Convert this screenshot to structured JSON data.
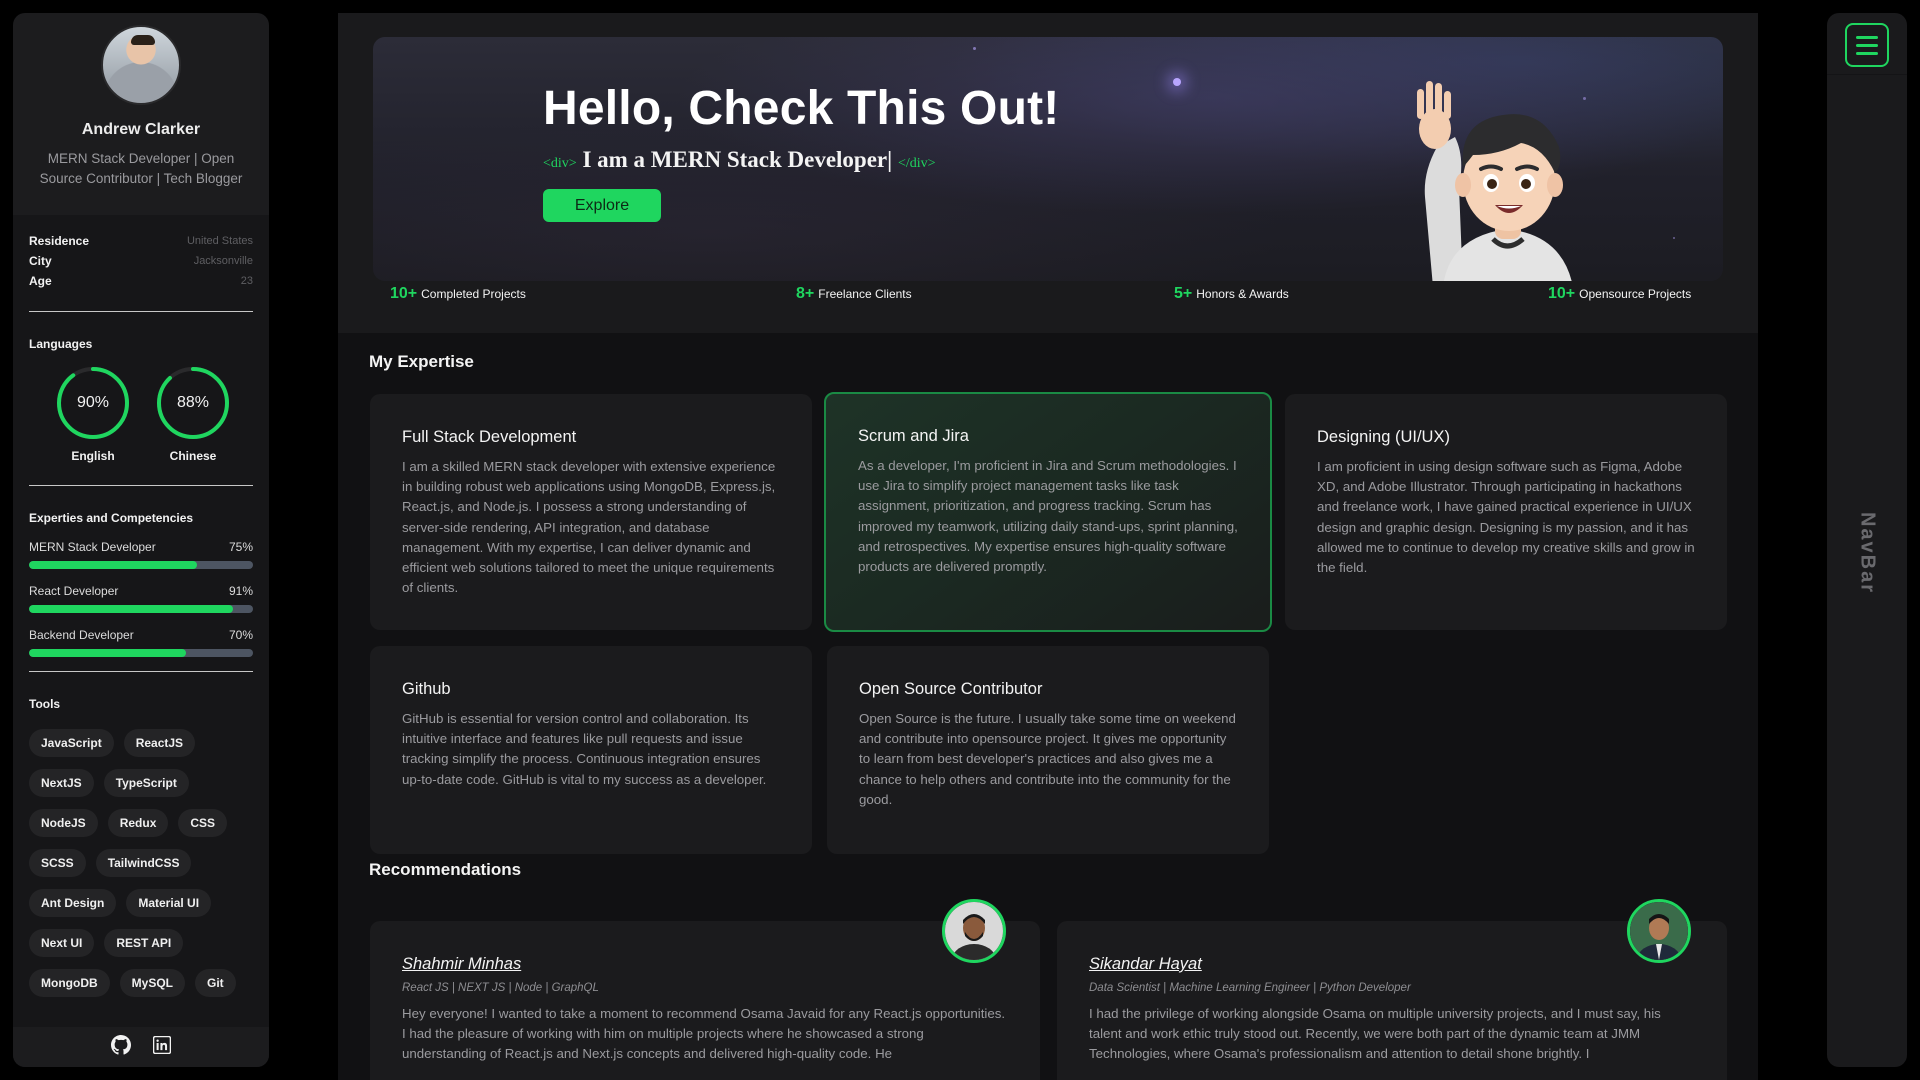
{
  "profile": {
    "name": "Andrew Clarker",
    "role": "MERN Stack Developer | Open Source Contributor | Tech Blogger",
    "info": [
      {
        "label": "Residence",
        "value": "United States"
      },
      {
        "label": "City",
        "value": "Jacksonville"
      },
      {
        "label": "Age",
        "value": "23"
      }
    ]
  },
  "languages": {
    "title": "Languages",
    "items": [
      {
        "name": "English",
        "percent_label": "90%",
        "level": 0.9
      },
      {
        "name": "Chinese",
        "percent_label": "88%",
        "level": 0.88
      }
    ]
  },
  "skills": {
    "title": "Experties and Competencies",
    "items": [
      {
        "name": "MERN Stack Developer",
        "percent_label": "75%",
        "level": 0.75
      },
      {
        "name": "React Developer",
        "percent_label": "91%",
        "level": 0.91
      },
      {
        "name": "Backend Developer",
        "percent_label": "70%",
        "level": 0.7
      }
    ]
  },
  "tools": {
    "title": "Tools",
    "items": [
      "JavaScript",
      "ReactJS",
      "NextJS",
      "TypeScript",
      "NodeJS",
      "Redux",
      "CSS",
      "SCSS",
      "TailwindCSS",
      "Ant Design",
      "Material UI",
      "Next UI",
      "REST API",
      "MongoDB",
      "MySQL",
      "Git"
    ]
  },
  "footer_icons": [
    "github-icon",
    "linkedin-icon"
  ],
  "hero": {
    "title": "Hello, Check This Out!",
    "tag_open": "<div>",
    "subtitle": "I am a MERN Stack Developer|",
    "tag_close": "</div>",
    "button": "Explore"
  },
  "stats": [
    {
      "number": "10+",
      "label": "Completed Projects"
    },
    {
      "number": "8+",
      "label": "Freelance Clients"
    },
    {
      "number": "5+",
      "label": "Honors & Awards"
    },
    {
      "number": "10+",
      "label": "Opensource Projects"
    }
  ],
  "expertise": {
    "title": "My Expertise",
    "cards": [
      {
        "title": "Full Stack Development",
        "text": "I am a skilled MERN stack developer with extensive experience in building robust web applications using MongoDB, Express.js, React.js, and Node.js. I possess a strong understanding of server-side rendering, API integration, and database management. With my expertise, I can deliver dynamic and efficient web solutions tailored to meet the unique requirements of clients."
      },
      {
        "title": "Scrum and Jira",
        "text": "As a developer, I'm proficient in Jira and Scrum methodologies. I use Jira to simplify project management tasks like task assignment, prioritization, and progress tracking. Scrum has improved my teamwork, utilizing daily stand-ups, sprint planning, and retrospectives. My expertise ensures high-quality software products are delivered promptly."
      },
      {
        "title": "Designing (UI/UX)",
        "text": "I am proficient in using design software such as Figma, Adobe XD, and Adobe Illustrator. Through participating in hackathons and freelance work, I have gained practical experience in UI/UX design and graphic design. Designing is my passion, and it has allowed me to continue to develop my creative skills and grow in the field."
      },
      {
        "title": "Github",
        "text": "GitHub is essential for version control and collaboration. Its intuitive interface and features like pull requests and issue tracking simplify the process. Continuous integration ensures up-to-date code. GitHub is vital to my success as a developer."
      },
      {
        "title": "Open Source Contributor",
        "text": "Open Source is the future. I usually take some time on weekend and contribute into opensource project. It gives me opportunity to learn from best developer's practices and also gives me a chance to help others and contribute into the community for the good."
      }
    ]
  },
  "recommendations": {
    "title": "Recommendations",
    "items": [
      {
        "name": "Shahmir Minhas",
        "role": "React JS | NEXT JS | Node | GraphQL",
        "text": "Hey everyone! I wanted to take a moment to recommend Osama Javaid for any React.js opportunities. I had the pleasure of working with him on multiple projects where he showcased a strong understanding of React.js and Next.js concepts and delivered high-quality code. He"
      },
      {
        "name": "Sikandar Hayat",
        "role": "Data Scientist | Machine Learning Engineer | Python Developer",
        "text": "I had the privilege of working alongside Osama on multiple university projects, and I must say, his talent and work ethic truly stood out. Recently, we were both part of the dynamic team at JMM Technologies, where Osama's professionalism and attention to detail shone brightly. I"
      }
    ]
  },
  "navbar": {
    "label": "NavBar",
    "menu_icon": "hamburger-menu-icon"
  },
  "colors": {
    "accent": "#1fd65f",
    "sidebar": "#1c1c1e",
    "main": "#111113",
    "card": "#1b1b1d"
  }
}
